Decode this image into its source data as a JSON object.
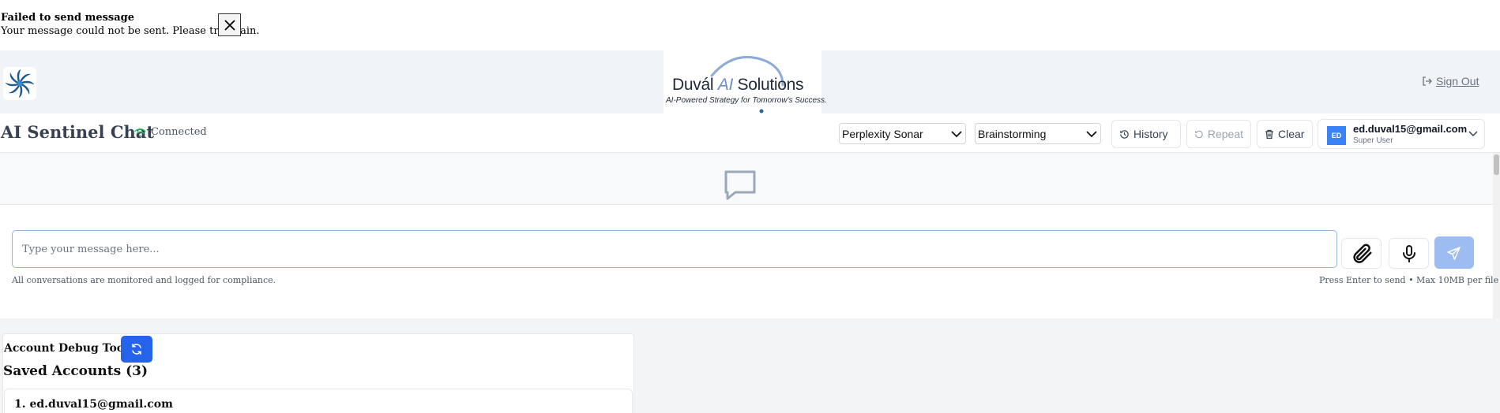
{
  "toast": {
    "title": "Failed to send message",
    "message": "Your message could not be sent. Please try again."
  },
  "header": {
    "brand_name_part1": "Duvál ",
    "brand_name_ai": "AI",
    "brand_name_part2": " Solutions",
    "brand_tagline": "AI-Powered Strategy for Tomorrow's Success.",
    "sign_out_label": "Sign Out"
  },
  "toolbar": {
    "title": "AI Sentinel Chat",
    "status_text": "Connected",
    "model_select": "Perplexity Sonar",
    "mode_select": "Brainstorming",
    "history_label": "History",
    "repeat_label": "Repeat",
    "clear_label": "Clear"
  },
  "user": {
    "initials": "ED",
    "email": "ed.duval15@gmail.com",
    "role": "Super User"
  },
  "composer": {
    "placeholder": "Type your message here...",
    "compliance_note": "All conversations are monitored and logged for compliance.",
    "hint": "Press Enter to send • Max 10MB per file"
  },
  "debug": {
    "title": "Account Debug Tool",
    "saved_accounts_title": "Saved Accounts (3)",
    "accounts": [
      "1. ed.duval15@gmail.com"
    ]
  },
  "colors": {
    "accent_blue": "#2563eb",
    "send_disabled": "#9dbcf2",
    "status_green": "#22c55e",
    "header_bg": "#f0f3f7"
  },
  "icons": {
    "toast_close": "close-icon",
    "app_logo": "swirl-logo-icon",
    "sign_out": "sign-out-icon",
    "status": "wifi-icon",
    "history": "history-icon",
    "repeat": "repeat-icon",
    "clear": "trash-icon",
    "empty_state": "chat-bubble-icon",
    "attach": "paperclip-icon",
    "mic": "microphone-icon",
    "send": "send-icon",
    "refresh": "refresh-icon"
  }
}
